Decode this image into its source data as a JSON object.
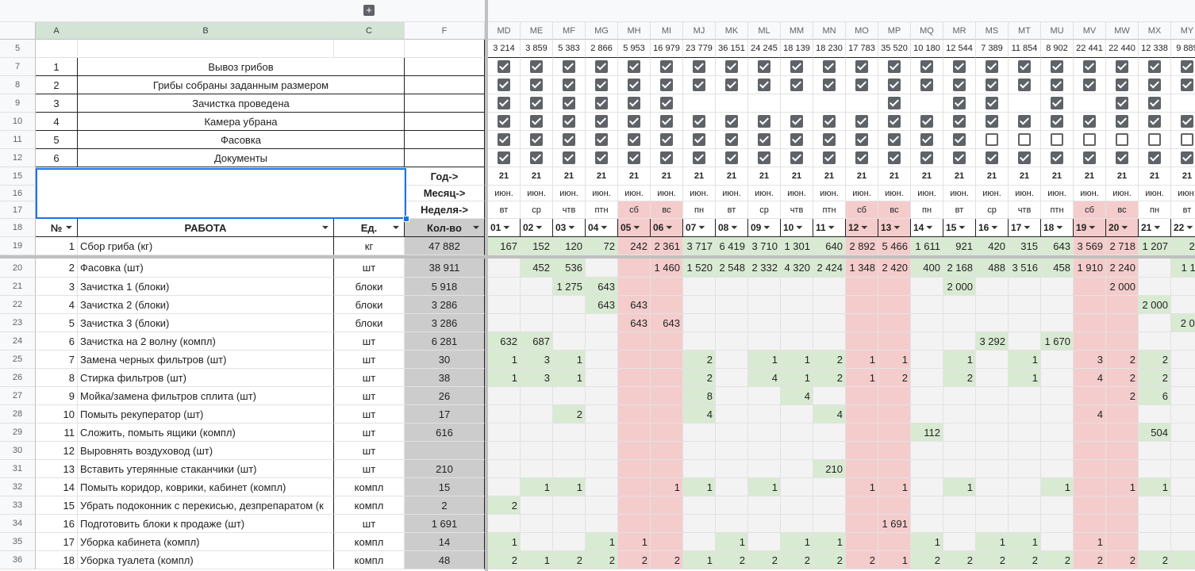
{
  "group_button": "+",
  "columns_left": [
    "A",
    "B",
    "C",
    "F"
  ],
  "columns_right": [
    "MD",
    "ME",
    "MF",
    "MG",
    "MH",
    "MI",
    "MJ",
    "MK",
    "ML",
    "MM",
    "MN",
    "MO",
    "MP",
    "MQ",
    "MR",
    "MS",
    "MT",
    "MU",
    "MV",
    "MW",
    "MX",
    "MY"
  ],
  "row_numbers": [
    "5",
    "7",
    "8",
    "9",
    "10",
    "11",
    "12",
    "15",
    "16",
    "17",
    "18",
    "19",
    "20",
    "21",
    "22",
    "23",
    "24",
    "25",
    "26",
    "27",
    "28",
    "29",
    "30",
    "31",
    "32",
    "33",
    "34",
    "35",
    "36"
  ],
  "totals": [
    "3 214",
    "3 859",
    "5 383",
    "2 866",
    "5 953",
    "16 979",
    "23 779",
    "36 151",
    "24 245",
    "18 139",
    "18 230",
    "17 783",
    "35 520",
    "10 180",
    "12 544",
    "7 389",
    "11 854",
    "8 902",
    "22 441",
    "22 440",
    "12 338",
    "9 889"
  ],
  "checklist": [
    {
      "num": "1",
      "label": "Вывоз грибов",
      "checks": [
        1,
        1,
        1,
        1,
        1,
        1,
        1,
        1,
        1,
        1,
        1,
        1,
        1,
        1,
        1,
        1,
        1,
        1,
        1,
        1,
        1,
        1
      ]
    },
    {
      "num": "2",
      "label": "Грибы собраны заданным размером",
      "checks": [
        1,
        1,
        1,
        1,
        1,
        1,
        1,
        1,
        1,
        1,
        1,
        1,
        1,
        1,
        1,
        1,
        1,
        1,
        1,
        1,
        1,
        1
      ]
    },
    {
      "num": "3",
      "label": "Зачистка проведена",
      "checks": [
        1,
        1,
        1,
        1,
        1,
        1,
        -1,
        -1,
        -1,
        -1,
        -1,
        -1,
        1,
        -1,
        1,
        1,
        -1,
        1,
        -1,
        1,
        1,
        -1
      ]
    },
    {
      "num": "4",
      "label": "Камера убрана",
      "checks": [
        1,
        1,
        1,
        1,
        1,
        1,
        1,
        1,
        1,
        1,
        1,
        1,
        1,
        1,
        1,
        1,
        1,
        1,
        1,
        1,
        1,
        1
      ]
    },
    {
      "num": "5",
      "label": "Фасовка",
      "checks": [
        1,
        1,
        1,
        1,
        1,
        1,
        1,
        1,
        1,
        1,
        1,
        1,
        1,
        1,
        1,
        0,
        0,
        0,
        0,
        0,
        0,
        0
      ]
    },
    {
      "num": "6",
      "label": "Документы",
      "checks": [
        1,
        1,
        1,
        1,
        1,
        1,
        1,
        1,
        1,
        1,
        1,
        1,
        1,
        1,
        1,
        1,
        1,
        1,
        1,
        1,
        1,
        1
      ]
    }
  ],
  "labels": {
    "year": "Год->",
    "month": "Месяц->",
    "week": "Неделя->"
  },
  "years": [
    "21",
    "21",
    "21",
    "21",
    "21",
    "21",
    "21",
    "21",
    "21",
    "21",
    "21",
    "21",
    "21",
    "21",
    "21",
    "21",
    "21",
    "21",
    "21",
    "21",
    "21",
    "21"
  ],
  "months": [
    "июн.",
    "июн.",
    "июн.",
    "июн.",
    "июн.",
    "июн.",
    "июн.",
    "июн.",
    "июн.",
    "июн.",
    "июн.",
    "июн.",
    "июн.",
    "июн.",
    "июн.",
    "июн.",
    "июн.",
    "июн.",
    "июн.",
    "июн.",
    "июн.",
    "июн."
  ],
  "weekdays": [
    "вт",
    "ср",
    "чтв",
    "птн",
    "сб",
    "вс",
    "пн",
    "вт",
    "ср",
    "чтв",
    "птн",
    "сб",
    "вс",
    "пн",
    "вт",
    "ср",
    "чтв",
    "птн",
    "сб",
    "вс",
    "пн",
    "вт"
  ],
  "weekend_cols": [
    4,
    5,
    11,
    12,
    18,
    19
  ],
  "header": {
    "num": "№",
    "work": "РАБОТА",
    "unit": "Ед.",
    "qty": "Кол-во",
    "days": [
      "01",
      "02",
      "03",
      "04",
      "05",
      "06",
      "07",
      "08",
      "09",
      "10",
      "11",
      "12",
      "13",
      "14",
      "15",
      "16",
      "17",
      "18",
      "19",
      "20",
      "21",
      "22"
    ]
  },
  "rows": [
    {
      "num": "1",
      "work": "Сбор гриба (кг)",
      "unit": "кг",
      "qty": "47 882",
      "vals": [
        "167",
        "152",
        "120",
        "72",
        "242",
        "2 361",
        "3 717",
        "6 419",
        "3 710",
        "1 301",
        "640",
        "2 892",
        "5 466",
        "1 611",
        "921",
        "420",
        "315",
        "643",
        "3 569",
        "2 718",
        "1 207",
        "24"
      ]
    },
    {
      "num": "2",
      "work": "Фасовка (шт)",
      "unit": "шт",
      "qty": "38 911",
      "vals": [
        "",
        "452",
        "536",
        "",
        "",
        "1 460",
        "1 520",
        "2 548",
        "2 332",
        "4 320",
        "2 424",
        "1 348",
        "2 420",
        "400",
        "2 168",
        "488",
        "3 516",
        "458",
        "1 910",
        "2 240",
        "",
        "1 11"
      ]
    },
    {
      "num": "3",
      "work": "Зачистка 1 (блоки)",
      "unit": "блоки",
      "qty": "5 918",
      "vals": [
        "",
        "",
        "1 275",
        "643",
        "",
        "",
        "",
        "",
        "",
        "",
        "",
        "",
        "",
        "",
        "2 000",
        "",
        "",
        "",
        "",
        "2 000",
        "",
        ""
      ]
    },
    {
      "num": "4",
      "work": "Зачистка 2 (блоки)",
      "unit": "блоки",
      "qty": "3 286",
      "vals": [
        "",
        "",
        "",
        "643",
        "643",
        "",
        "",
        "",
        "",
        "",
        "",
        "",
        "",
        "",
        "",
        "",
        "",
        "",
        "",
        "",
        "2 000",
        ""
      ]
    },
    {
      "num": "5",
      "work": "Зачистка 3 (блоки)",
      "unit": "блоки",
      "qty": "3 286",
      "vals": [
        "",
        "",
        "",
        "",
        "643",
        "643",
        "",
        "",
        "",
        "",
        "",
        "",
        "",
        "",
        "",
        "",
        "",
        "",
        "",
        "",
        "",
        "2 00"
      ]
    },
    {
      "num": "6",
      "work": "Зачистка на 2 волну (компл)",
      "unit": "шт",
      "qty": "6 281",
      "vals": [
        "632",
        "687",
        "",
        "",
        "",
        "",
        "",
        "",
        "",
        "",
        "",
        "",
        "",
        "",
        "",
        "3 292",
        "",
        "1 670",
        "",
        "",
        "",
        ""
      ]
    },
    {
      "num": "7",
      "work": "Замена черных фильтров (шт)",
      "unit": "шт",
      "qty": "30",
      "vals": [
        "1",
        "3",
        "1",
        "",
        "",
        "",
        "2",
        "",
        "1",
        "1",
        "2",
        "1",
        "1",
        "",
        "1",
        "",
        "1",
        "",
        "3",
        "2",
        "2",
        ""
      ]
    },
    {
      "num": "8",
      "work": "Стирка фильтров (шт)",
      "unit": "шт",
      "qty": "38",
      "vals": [
        "1",
        "3",
        "1",
        "",
        "",
        "",
        "2",
        "",
        "4",
        "1",
        "2",
        "1",
        "2",
        "",
        "2",
        "",
        "1",
        "",
        "4",
        "2",
        "2",
        ""
      ]
    },
    {
      "num": "9",
      "work": "Мойка/замена фильтров сплита (шт)",
      "unit": "шт",
      "qty": "26",
      "vals": [
        "",
        "",
        "",
        "",
        "",
        "",
        "8",
        "",
        "",
        "4",
        "",
        "",
        "",
        "",
        "",
        "",
        "",
        "",
        "",
        "2",
        "6",
        ""
      ]
    },
    {
      "num": "10",
      "work": "Помыть рекуператор (шт)",
      "unit": "шт",
      "qty": "17",
      "vals": [
        "",
        "",
        "2",
        "",
        "",
        "",
        "4",
        "",
        "",
        "",
        "4",
        "",
        "",
        "",
        "",
        "",
        "",
        "",
        "4",
        "",
        "",
        ""
      ]
    },
    {
      "num": "11",
      "work": "Сложить, помыть ящики (компл)",
      "unit": "шт",
      "qty": "616",
      "vals": [
        "",
        "",
        "",
        "",
        "",
        "",
        "",
        "",
        "",
        "",
        "",
        "",
        "",
        "112",
        "",
        "",
        "",
        "",
        "",
        "",
        "504",
        ""
      ]
    },
    {
      "num": "12",
      "work": "Выровнять воздуховод (шт)",
      "unit": "шт",
      "qty": "",
      "vals": [
        "",
        "",
        "",
        "",
        "",
        "",
        "",
        "",
        "",
        "",
        "",
        "",
        "",
        "",
        "",
        "",
        "",
        "",
        "",
        "",
        "",
        ""
      ]
    },
    {
      "num": "13",
      "work": "Вставить утерянные стаканчики (шт)",
      "unit": "шт",
      "qty": "210",
      "vals": [
        "",
        "",
        "",
        "",
        "",
        "",
        "",
        "",
        "",
        "",
        "210",
        "",
        "",
        "",
        "",
        "",
        "",
        "",
        "",
        "",
        "",
        ""
      ]
    },
    {
      "num": "14",
      "work": "Помыть коридор, коврики, кабинет (компл)",
      "unit": "компл",
      "qty": "15",
      "vals": [
        "",
        "1",
        "1",
        "",
        "",
        "1",
        "1",
        "",
        "1",
        "",
        "",
        "1",
        "1",
        "",
        "1",
        "",
        "",
        "1",
        "",
        "1",
        "1",
        ""
      ]
    },
    {
      "num": "15",
      "work": "Убрать подоконник с перекисью, дезпрепаратом (к",
      "unit": "компл",
      "qty": "2",
      "vals": [
        "2",
        "",
        "",
        "",
        "",
        "",
        "",
        "",
        "",
        "",
        "",
        "",
        "",
        "",
        "",
        "",
        "",
        "",
        "",
        "",
        "",
        ""
      ]
    },
    {
      "num": "16",
      "work": "Подготовить блоки к продаже (шт)",
      "unit": "шт",
      "qty": "1 691",
      "vals": [
        "",
        "",
        "",
        "",
        "",
        "",
        "",
        "",
        "",
        "",
        "",
        "",
        "1 691",
        "",
        "",
        "",
        "",
        "",
        "",
        "",
        "",
        ""
      ]
    },
    {
      "num": "17",
      "work": "Уборка кабинета (компл)",
      "unit": "компл",
      "qty": "14",
      "vals": [
        "1",
        "",
        "",
        "1",
        "1",
        "",
        "",
        "1",
        "",
        "1",
        "1",
        "",
        "",
        "1",
        "",
        "1",
        "1",
        "",
        "1",
        "",
        "",
        ""
      ]
    },
    {
      "num": "18",
      "work": "Уборка туалета (компл)",
      "unit": "компл",
      "qty": "48",
      "vals": [
        "2",
        "1",
        "2",
        "2",
        "2",
        "2",
        "1",
        "2",
        "2",
        "2",
        "2",
        "2",
        "1",
        "2",
        "2",
        "2",
        "2",
        "2",
        "2",
        "2",
        "2",
        "2"
      ]
    }
  ]
}
